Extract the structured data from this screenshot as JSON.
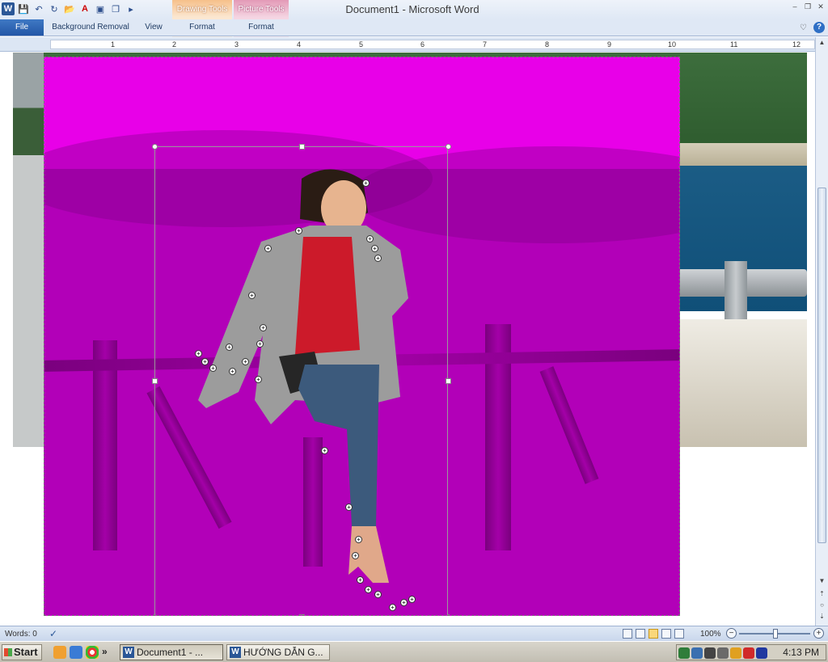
{
  "window": {
    "title": "Document1 - Microsoft Word",
    "app_logo": "W"
  },
  "qat": {
    "icons": [
      "word-logo-icon",
      "save-icon",
      "undo-icon",
      "redo-icon",
      "open-icon",
      "font-color-icon",
      "picture-icon",
      "copy-icon",
      "more-icon"
    ]
  },
  "contextual_tabs": {
    "drawing_tools": "Drawing Tools",
    "picture_tools": "Picture Tools"
  },
  "ribbon": {
    "file": "File",
    "background_removal": "Background Removal",
    "view": "View",
    "format_drawing": "Format",
    "format_picture": "Format"
  },
  "ruler": {
    "numbers": [
      "1",
      "2",
      "3",
      "4",
      "5",
      "6",
      "7",
      "8",
      "9",
      "10",
      "11",
      "12"
    ]
  },
  "statusbar": {
    "words": "Words: 0",
    "zoom": "100%",
    "zoom_level": 100
  },
  "taskbar": {
    "start": "Start",
    "quicklaunch_more": "»",
    "tasks": [
      "Document1 - ...",
      "HƯỚNG DẪN G..."
    ],
    "time": "4:13 PM"
  },
  "colors": {
    "removal_overlay": "#b200b8",
    "sky_overlay": "#e800e8",
    "word_blue": "#2b5797"
  }
}
